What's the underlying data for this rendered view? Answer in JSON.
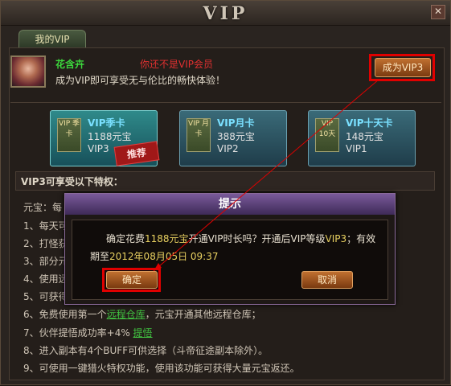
{
  "window": {
    "title": "VIP",
    "close": "✕"
  },
  "tab": {
    "label": "我的VIP"
  },
  "player": {
    "name": "花含卉",
    "status": "你还不是VIP会员",
    "intro": "成为VIP即可享受无与伦比的畅快体验！"
  },
  "become_vip_button": "成为VIP3",
  "cards": [
    {
      "icon": "VIP 季卡",
      "name": "VIP季卡",
      "price": "1188元宝",
      "level": "VIP3"
    },
    {
      "icon": "VIP 月卡",
      "name": "VIP月卡",
      "price": "388元宝",
      "level": "VIP2"
    },
    {
      "icon": "VIP 10天",
      "name": "VIP十天卡",
      "price": "148元宝",
      "level": "VIP1"
    }
  ],
  "recommend_stamp": "推荐",
  "privileges_title": "VIP3可享受以下特权：",
  "privileges": [
    {
      "text": "元宝：每"
    },
    {
      "text": "1、每天可"
    },
    {
      "text": "2、打怪获"
    },
    {
      "text": "3、部分元"
    },
    {
      "text": "4、使用远"
    },
    {
      "text": "5、可获得"
    },
    {
      "pre": "6、免费使用第一个",
      "link": "远程仓库",
      "post": "，元宝开通其他远程仓库；"
    },
    {
      "pre": "7、伙伴提悟成功率+4%  ",
      "link": "提悟",
      "post": ""
    },
    {
      "text": "8、进入副本有4个BUFF可供选择（斗帝征途副本除外）。"
    },
    {
      "text": "9、可使用一键猎火特权功能，使用该功能可获得大量元宝返还。"
    }
  ],
  "dialog": {
    "title": "提示",
    "line1_a": "确定花费",
    "line1_price": "1188元宝",
    "line1_b": "开通VIP时长吗？开通后VIP等级",
    "line1_level": "VIP3",
    "line1_c": "；有效",
    "line2_a": "期至",
    "line2_date": "2012年08月05日 09:37",
    "confirm": "确定",
    "cancel": "取消"
  },
  "colors": {
    "highlight_box": "#e00000",
    "name_green": "#3cd83c",
    "warn_red": "#e03030",
    "gold": "#e8d060"
  }
}
